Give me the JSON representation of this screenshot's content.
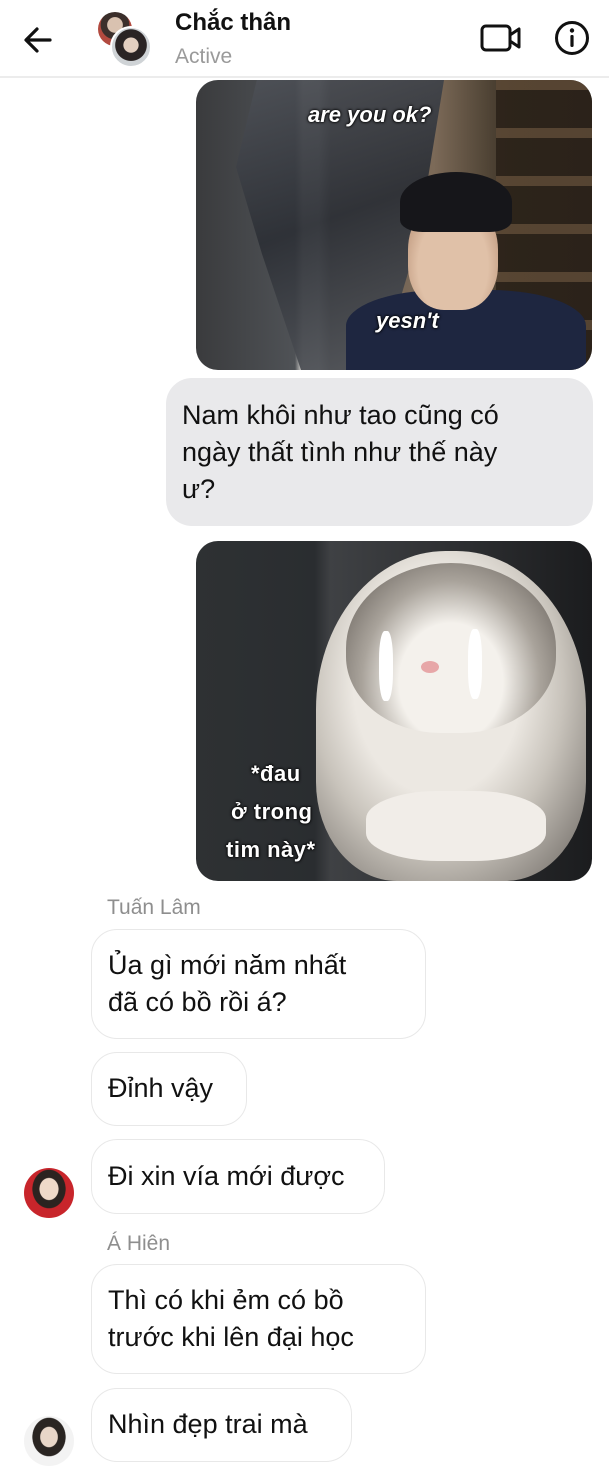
{
  "header": {
    "title": "Chắc thân",
    "status": "Active",
    "back_icon": "arrow-left-icon",
    "video_icon": "video-camera-icon",
    "info_icon": "info-circle-icon"
  },
  "messages": {
    "meme_1": {
      "top_caption": "are you ok?",
      "bottom_caption": "yesn't"
    },
    "outgoing_text": {
      "line1": "Nam khôi như tao cũng có",
      "line2": "ngày thất tình như thế này",
      "line3": "ư?"
    },
    "meme_2": {
      "line1": "*đau",
      "line2": "ở trong",
      "line3": "tim này*"
    },
    "tuan_lam": {
      "sender": "Tuấn Lâm",
      "msg1_line1": "Ủa gì mới năm nhất",
      "msg1_line2": "đã có bồ rồi á?",
      "msg2": "Đỉnh vậy",
      "msg3": "Đi xin vía mới được"
    },
    "a_hien": {
      "sender": "Á Hiên",
      "msg1_line1": "Thì có khi ẻm có bồ",
      "msg1_line2": "trước khi lên đại học",
      "msg2": "Nhìn đẹp trai mà"
    }
  },
  "colors": {
    "outgoing_bubble": "#e9e9eb",
    "incoming_border": "#e8e8e8",
    "muted_text": "#9a9a9a"
  }
}
